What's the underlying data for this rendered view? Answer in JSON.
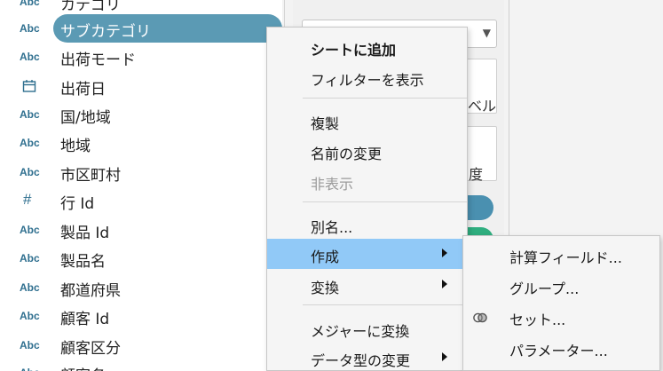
{
  "data_pane": {
    "fields": [
      {
        "type_icon": "Abc",
        "label": "カテゴリ",
        "selected": false
      },
      {
        "type_icon": "Abc",
        "label": "サブカテゴリ",
        "selected": true
      },
      {
        "type_icon": "Abc",
        "label": "出荷モード",
        "selected": false
      },
      {
        "type_icon": "calendar-icon",
        "label": "出荷日",
        "selected": false
      },
      {
        "type_icon": "Abc",
        "label": "国/地域",
        "selected": false
      },
      {
        "type_icon": "Abc",
        "label": "地域",
        "selected": false
      },
      {
        "type_icon": "Abc",
        "label": "市区町村",
        "selected": false
      },
      {
        "type_icon": "#",
        "label": "行 Id",
        "selected": false
      },
      {
        "type_icon": "Abc",
        "label": "製品 Id",
        "selected": false
      },
      {
        "type_icon": "Abc",
        "label": "製品名",
        "selected": false
      },
      {
        "type_icon": "Abc",
        "label": "都道府県",
        "selected": false
      },
      {
        "type_icon": "Abc",
        "label": "顧客 Id",
        "selected": false
      },
      {
        "type_icon": "Abc",
        "label": "顧客区分",
        "selected": false
      },
      {
        "type_icon": "Abc",
        "label": "顧客名",
        "selected": false
      }
    ],
    "selected_color": "#5b9ab4",
    "type_icon_color": "#2f6f8f"
  },
  "background": {
    "partial_label_1": "ベル",
    "partial_label_2": "度"
  },
  "context_menu": {
    "items": [
      {
        "label": "シートに追加",
        "bold": true,
        "disabled": false,
        "submenu": false,
        "highlighted": false
      },
      {
        "label": "フィルターを表示",
        "bold": false,
        "disabled": false,
        "submenu": false,
        "highlighted": false
      },
      {
        "label": "複製",
        "bold": false,
        "disabled": false,
        "submenu": false,
        "highlighted": false
      },
      {
        "label": "名前の変更",
        "bold": false,
        "disabled": false,
        "submenu": false,
        "highlighted": false
      },
      {
        "label": "非表示",
        "bold": false,
        "disabled": true,
        "submenu": false,
        "highlighted": false
      },
      {
        "label": "別名...",
        "bold": false,
        "disabled": false,
        "submenu": false,
        "highlighted": false
      },
      {
        "label": "作成",
        "bold": false,
        "disabled": false,
        "submenu": true,
        "highlighted": true
      },
      {
        "label": "変換",
        "bold": false,
        "disabled": false,
        "submenu": true,
        "highlighted": false
      },
      {
        "label": "メジャーに変換",
        "bold": false,
        "disabled": false,
        "submenu": false,
        "highlighted": false
      },
      {
        "label": "データ型の変更",
        "bold": false,
        "disabled": false,
        "submenu": true,
        "highlighted": false
      }
    ],
    "highlight_color": "#91c9f7"
  },
  "submenu": {
    "items": [
      {
        "label": "計算フィールド...",
        "icon": ""
      },
      {
        "label": "グループ...",
        "icon": ""
      },
      {
        "label": "セット...",
        "icon": "set-icon"
      },
      {
        "label": "パラメーター...",
        "icon": ""
      }
    ]
  }
}
